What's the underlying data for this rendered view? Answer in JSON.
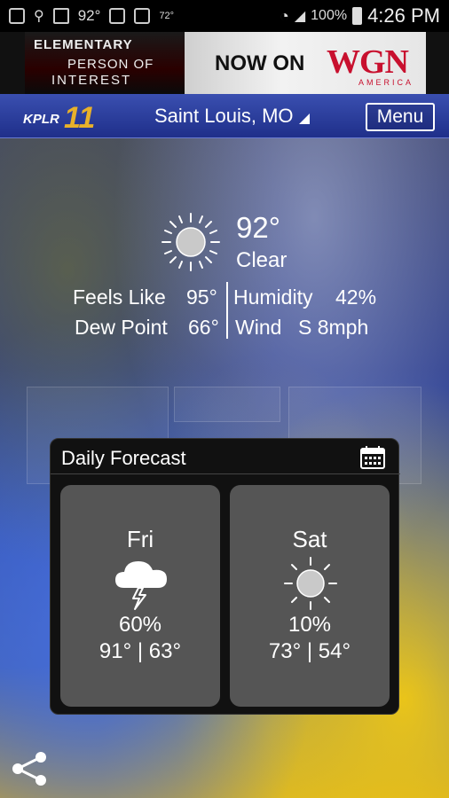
{
  "status_bar": {
    "temp": "92°",
    "mini_temp": "72°",
    "battery": "100%",
    "time": "4:26 PM"
  },
  "ad": {
    "show": "ELEMENTARY",
    "show2_line1": "PERSON OF",
    "show2_line2": "INTEREST",
    "cta": "NOW ON",
    "network": "WGN",
    "network_sub": "AMERICA"
  },
  "header": {
    "logo_text": "KPLR",
    "logo_num": "11",
    "location": "Saint Louis, MO",
    "menu_label": "Menu"
  },
  "current": {
    "icon": "sun-icon",
    "temp": "92°",
    "condition": "Clear",
    "feels_like_label": "Feels Like",
    "feels_like_value": "95°",
    "humidity_label": "Humidity",
    "humidity_value": "42%",
    "dew_point_label": "Dew Point",
    "dew_point_value": "66°",
    "wind_label": "Wind",
    "wind_value": "S 8mph"
  },
  "daily": {
    "title": "Daily Forecast",
    "days": [
      {
        "name": "Fri",
        "icon": "thunderstorm-icon",
        "pop": "60%",
        "temps": "91° | 63°"
      },
      {
        "name": "Sat",
        "icon": "sun-icon",
        "pop": "10%",
        "temps": "73° | 54°"
      }
    ]
  },
  "colors": {
    "header": "#2a3a9a",
    "card": "#555555",
    "accent": "#e8b12a"
  }
}
